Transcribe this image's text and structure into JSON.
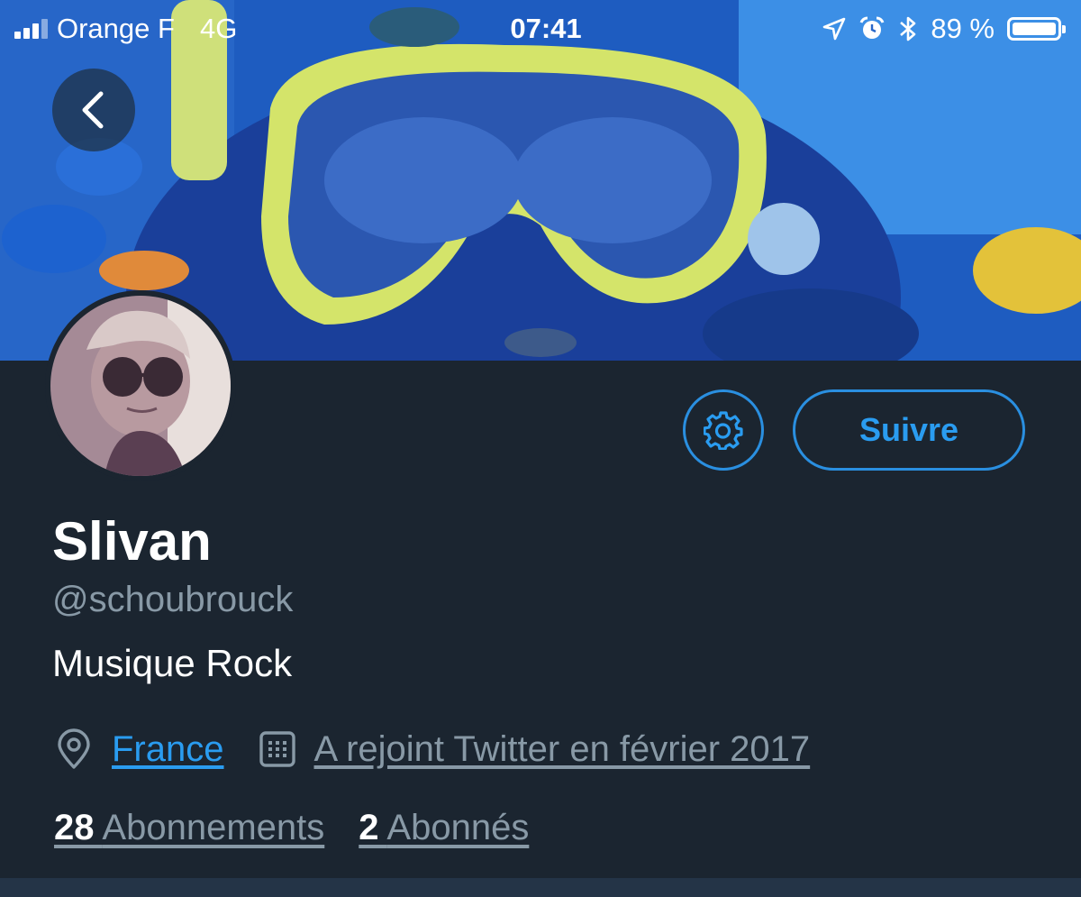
{
  "status_bar": {
    "carrier": "Orange F",
    "network": "4G",
    "time": "07:41",
    "battery": "89 %",
    "battery_level": 0.89
  },
  "profile": {
    "name": "Slivan",
    "handle": "@schoubrouck",
    "bio": "Musique Rock",
    "location": "France",
    "joined": "A rejoint Twitter en février 2017",
    "following_count": "28",
    "following_label": "Abonnements",
    "followers_count": "2",
    "followers_label": "Abonnés"
  },
  "actions": {
    "follow_label": "Suivre"
  },
  "icons": [
    "back-icon",
    "gear-icon",
    "location-pin-icon",
    "calendar-icon",
    "location-arrow-icon",
    "alarm-icon",
    "bluetooth-icon"
  ],
  "colors": {
    "background": "#1b2530",
    "accent": "#2a9cf0",
    "muted_text": "#8899a6"
  }
}
